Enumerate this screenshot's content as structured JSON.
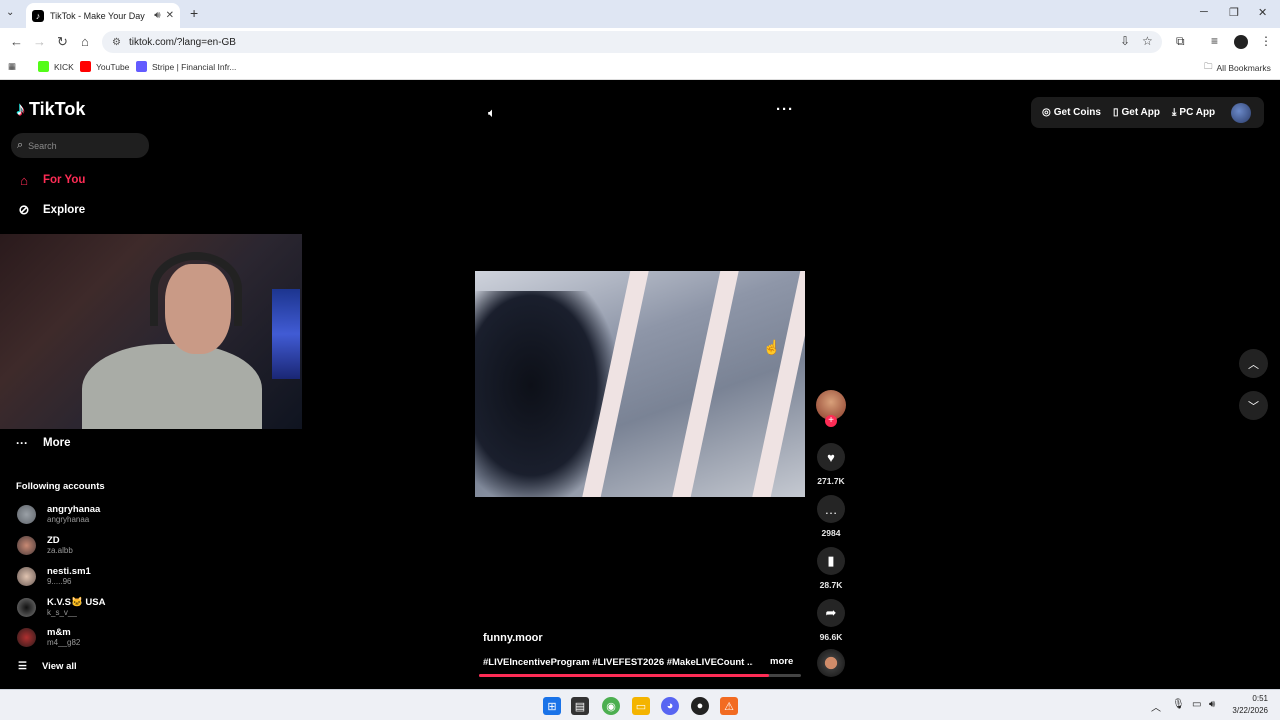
{
  "browser": {
    "tab_title": "TikTok - Make Your Day",
    "url": "tiktok.com/?lang=en-GB",
    "bookmarks": [
      {
        "label": "KICK",
        "color": "#53fc18"
      },
      {
        "label": "YouTube",
        "color": "#ff0000"
      },
      {
        "label": "Stripe | Financial Infr...",
        "color": "#635bff"
      }
    ],
    "all_bookmarks": "All Bookmarks"
  },
  "sidebar": {
    "logo": "TikTok",
    "search_placeholder": "Search",
    "nav": [
      {
        "label": "For You",
        "icon": "home-icon",
        "active": true
      },
      {
        "label": "Explore",
        "icon": "compass-icon",
        "active": false
      }
    ],
    "more": "More",
    "following_title": "Following accounts",
    "accounts": [
      {
        "name": "angryhanaa",
        "username": "angryhanaa"
      },
      {
        "name": "ZD",
        "username": "za.albb"
      },
      {
        "name": "nesti.sm1",
        "username": "9.....96"
      },
      {
        "name": "K.V.S🐱 USA",
        "username": "k_s_v__"
      },
      {
        "name": "m&m",
        "username": "m4__g82"
      }
    ],
    "view_all": "View all"
  },
  "topbar": {
    "get_coins": "Get Coins",
    "get_app": "Get App",
    "pc_app": "PC App"
  },
  "video": {
    "author": "funny.moor",
    "caption": "#LIVEIncentiveProgram #LIVEFEST2026 #MakeLIVECount ...",
    "more": "more",
    "progress": 0.9,
    "likes": "271.7K",
    "comments": "2984",
    "saves": "28.7K",
    "shares": "96.6K"
  },
  "taskbar": {
    "time": "0:51",
    "date": "3/22/2026"
  },
  "colors": {
    "accent": "#fe2c55",
    "background": "#000000"
  }
}
